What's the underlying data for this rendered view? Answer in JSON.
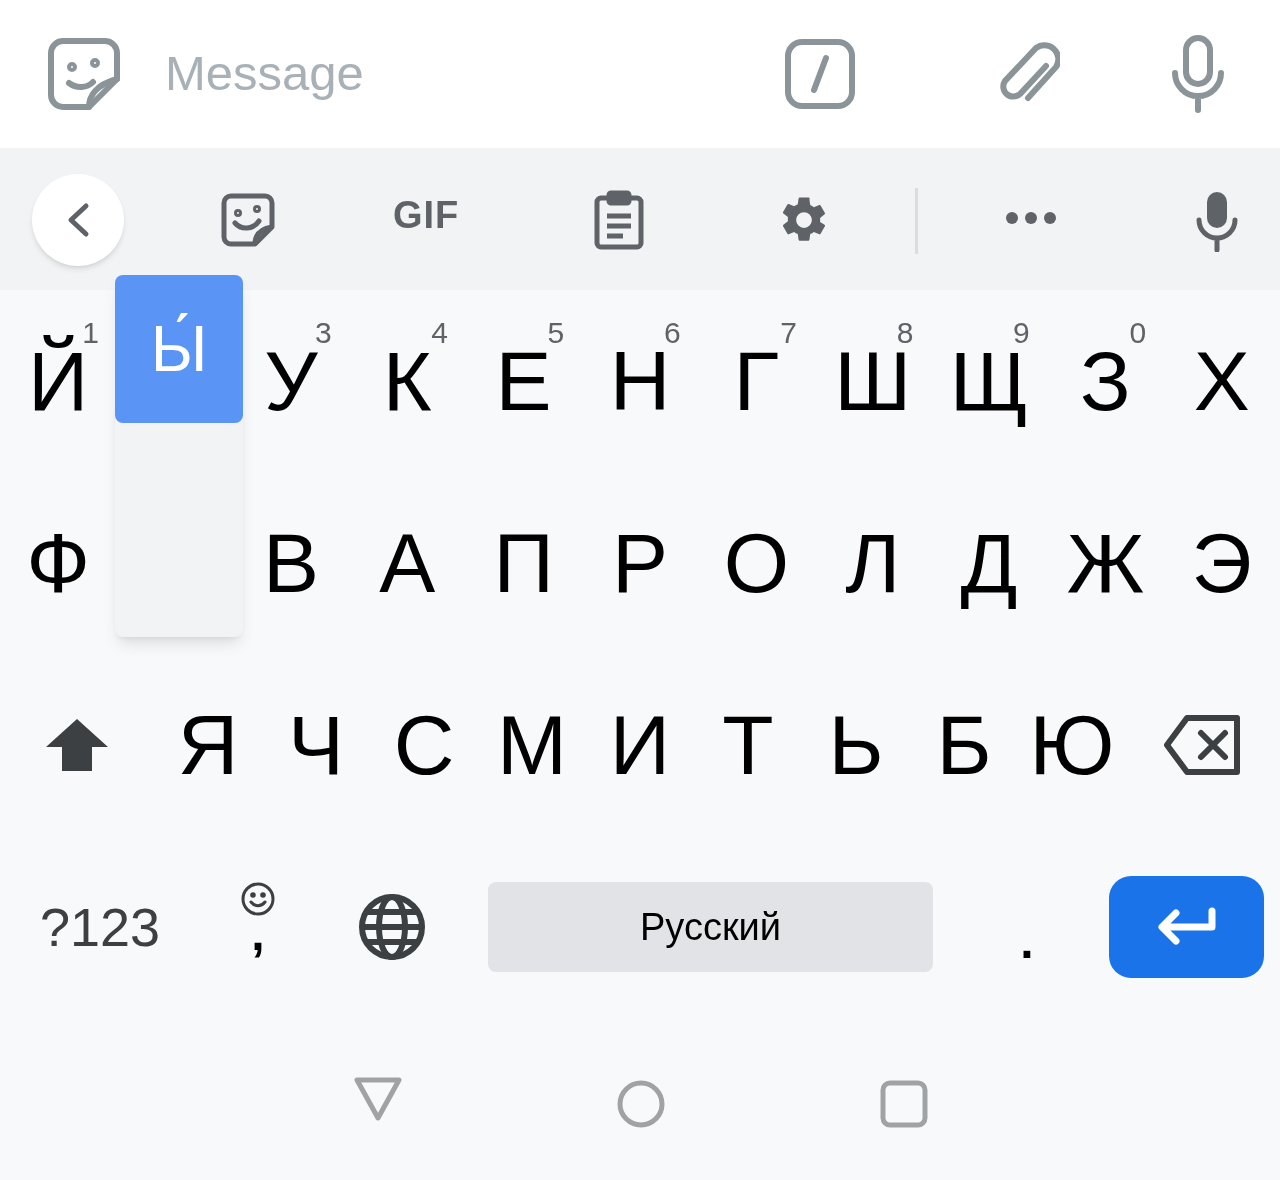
{
  "message_bar": {
    "placeholder": "Message"
  },
  "toolbar": {
    "gif_label": "GIF"
  },
  "rows": [
    [
      {
        "kind": "letter",
        "label": "Й",
        "hint": "1"
      },
      {
        "kind": "covered"
      },
      {
        "kind": "letter",
        "label": "У",
        "hint": "3"
      },
      {
        "kind": "letter",
        "label": "К",
        "hint": "4"
      },
      {
        "kind": "letter",
        "label": "Е",
        "hint": "5"
      },
      {
        "kind": "letter",
        "label": "Н",
        "hint": "6"
      },
      {
        "kind": "letter",
        "label": "Г",
        "hint": "7"
      },
      {
        "kind": "letter",
        "label": "Ш",
        "hint": "8"
      },
      {
        "kind": "letter",
        "label": "Щ",
        "hint": "9"
      },
      {
        "kind": "letter",
        "label": "З",
        "hint": "0"
      },
      {
        "kind": "letter",
        "label": "Х"
      }
    ],
    [
      {
        "kind": "letter",
        "label": "Ф"
      },
      {
        "kind": "covered"
      },
      {
        "kind": "letter",
        "label": "В"
      },
      {
        "kind": "letter",
        "label": "А"
      },
      {
        "kind": "letter",
        "label": "П"
      },
      {
        "kind": "letter",
        "label": "Р"
      },
      {
        "kind": "letter",
        "label": "О"
      },
      {
        "kind": "letter",
        "label": "Л"
      },
      {
        "kind": "letter",
        "label": "Д"
      },
      {
        "kind": "letter",
        "label": "Ж"
      },
      {
        "kind": "letter",
        "label": "Э"
      }
    ],
    [
      {
        "kind": "shift"
      },
      {
        "kind": "letter",
        "label": "Я"
      },
      {
        "kind": "letter",
        "label": "Ч"
      },
      {
        "kind": "letter",
        "label": "С"
      },
      {
        "kind": "letter",
        "label": "М"
      },
      {
        "kind": "letter",
        "label": "И"
      },
      {
        "kind": "letter",
        "label": "Т"
      },
      {
        "kind": "letter",
        "label": "Ь"
      },
      {
        "kind": "letter",
        "label": "Б"
      },
      {
        "kind": "letter",
        "label": "Ю"
      },
      {
        "kind": "backspace"
      }
    ]
  ],
  "bottom_row": {
    "symbols": "?123",
    "comma": ",",
    "space": "Русский",
    "period": "."
  },
  "popup": {
    "label": "Ы́"
  }
}
